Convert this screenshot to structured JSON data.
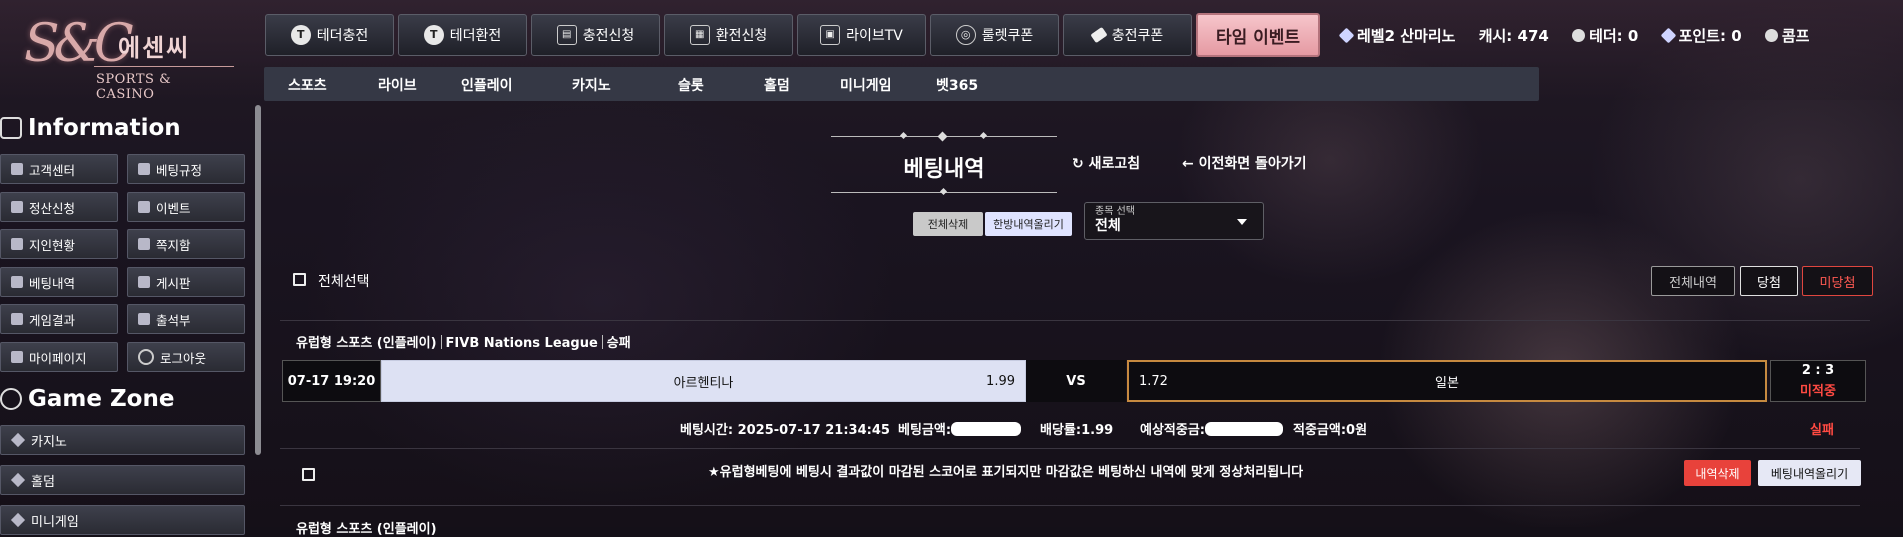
{
  "logo": {
    "mark": "S&C",
    "korean": "에센씨",
    "english": "SPORTS & CASINO"
  },
  "top_buttons": [
    {
      "label": "테더충전",
      "icon": "tether-icon"
    },
    {
      "label": "테더환전",
      "icon": "tether-icon"
    },
    {
      "label": "충전신청",
      "icon": "coins-icon"
    },
    {
      "label": "환전신청",
      "icon": "cash-icon"
    },
    {
      "label": "라이브TV",
      "icon": "tv-icon"
    },
    {
      "label": "룰렛쿠폰",
      "icon": "roulette-icon"
    },
    {
      "label": "충전쿠폰",
      "icon": "ticket-icon"
    }
  ],
  "event_button": "타임 이벤트",
  "user": {
    "level": "레벨2 산마리노",
    "cash": "캐시: 474",
    "tether": "테더: 0",
    "points": "포인트: 0",
    "comp": "콤프"
  },
  "nav": [
    "스포츠",
    "라이브",
    "인플레이",
    "카지노",
    "슬롯",
    "홀덤",
    "미니게임",
    "벳365"
  ],
  "sidebar": {
    "info_title": "Information",
    "info_items": [
      "고객센터",
      "베팅규정",
      "정산신청",
      "이벤트",
      "지인현황",
      "쪽지함",
      "베팅내역",
      "게시판",
      "게임결과",
      "출석부",
      "마이페이지",
      "로그아웃"
    ],
    "game_title": "Game Zone",
    "game_items": [
      "카지노",
      "홀덤",
      "미니게임"
    ]
  },
  "page": {
    "title": "베팅내역",
    "refresh": "새로고침",
    "back": "이전화면 돌아가기",
    "delete_all": "전체삭제",
    "bulk_upload": "한방내역올리기",
    "select_label": "종목 선택",
    "select_value": "전체",
    "select_all": "전체선택",
    "filters": [
      "전체내역",
      "당첨",
      "미당첨"
    ]
  },
  "bet": {
    "league_type": "유럽형 스포츠 (인플레이)",
    "league": "FIVB Nations League",
    "market": "승패",
    "time": "07-17 19:20",
    "home": "아르헨티나",
    "home_odds": "1.99",
    "vs": "VS",
    "away_odds": "1.72",
    "away": "일본",
    "score": "2 : 3",
    "status": "미적중",
    "bet_time": "베팅시간: 2025-07-17 21:34:45",
    "bet_amount": "베팅금액:",
    "bet_odds": "배당률:1.99",
    "expected": "예상적중금:",
    "win_amount": "적중금액:0원",
    "result": "실패",
    "notice": "★유럽형베팅에 베팅시 결과값이 마감된 스코어로 표기되지만 마감값은 베팅하신 내역에 맞게 정상처리됩니다",
    "delete_btn": "내역삭제",
    "upload_btn": "베팅내역올리기"
  },
  "next_row": "유럽형 스포츠 (인플레이)"
}
